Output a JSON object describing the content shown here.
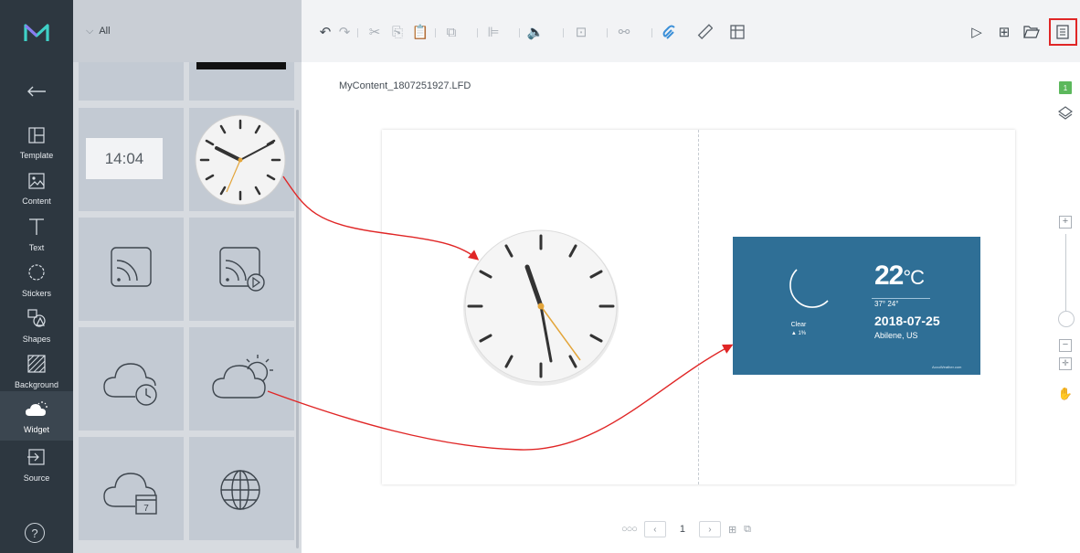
{
  "sidebar": {
    "items": [
      {
        "label": "Template",
        "icon": "template-icon"
      },
      {
        "label": "Content",
        "icon": "content-icon"
      },
      {
        "label": "Text",
        "icon": "text-icon"
      },
      {
        "label": "Stickers",
        "icon": "stickers-icon"
      },
      {
        "label": "Shapes",
        "icon": "shapes-icon"
      },
      {
        "label": "Background",
        "icon": "background-icon"
      },
      {
        "label": "Widget",
        "icon": "widget-icon",
        "active": true
      },
      {
        "label": "Source",
        "icon": "source-icon"
      }
    ],
    "help": "?"
  },
  "panel": {
    "filter_label": "All",
    "tiles": [
      {
        "name": "digital-clock",
        "text": "14:04"
      },
      {
        "name": "analog-clock"
      },
      {
        "name": "rss-feed"
      },
      {
        "name": "rss-video-feed"
      },
      {
        "name": "cloud-clock"
      },
      {
        "name": "weather"
      },
      {
        "name": "cloud-calendar",
        "text": "7"
      },
      {
        "name": "web-browser"
      }
    ]
  },
  "editor": {
    "filename": "MyContent_1807251927.LFD",
    "weather_widget": {
      "temperature": "22",
      "unit": "°C",
      "range": "37° 24°",
      "condition": "Clear",
      "precipitation": "1%",
      "date": "2018-07-25",
      "location": "Abilene, US",
      "brand": "AccuWeather.com"
    }
  },
  "rightbar": {
    "layer_badge": "1"
  },
  "pager": {
    "current_page": "1"
  },
  "colors": {
    "annotation_arrow": "#e02626",
    "sidebar_bg": "#2d3740",
    "weather_bg": "#2f6f96",
    "layer_badge": "#5cb85c"
  }
}
